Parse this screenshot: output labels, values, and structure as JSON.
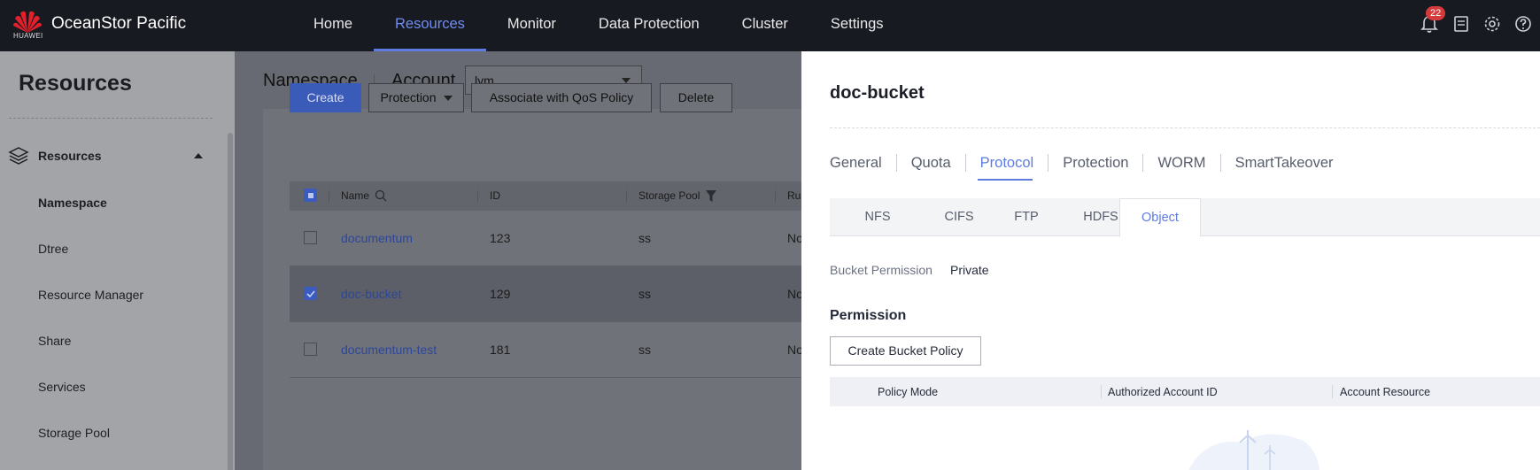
{
  "brand": {
    "company": "HUAWEI",
    "app_title": "OceanStor Pacific",
    "logo_color": "#e0202b"
  },
  "nav": {
    "items": [
      "Home",
      "Resources",
      "Monitor",
      "Data Protection",
      "Cluster",
      "Settings"
    ],
    "active": "Resources"
  },
  "topbar": {
    "notification_count": "22",
    "icons": [
      "bell-icon",
      "document-icon",
      "gear-icon",
      "help-icon"
    ]
  },
  "sidebar": {
    "title": "Resources",
    "group": {
      "label": "Resources",
      "icon": "layers-icon",
      "expanded": true
    },
    "items": [
      "Namespace",
      "Dtree",
      "Resource Manager",
      "Share",
      "Services",
      "Storage Pool"
    ],
    "active": "Namespace"
  },
  "main": {
    "title": "Namespace",
    "account_label": "Account",
    "account_value": "lym",
    "toolbar": {
      "create": "Create",
      "protection": "Protection",
      "associate_qos": "Associate with QoS Policy",
      "delete": "Delete"
    },
    "table": {
      "columns": [
        "Name",
        "ID",
        "Storage Pool",
        "Ru"
      ],
      "rows": [
        {
          "name": "documentum",
          "id": "123",
          "pool": "ss",
          "extra": "No",
          "checked": false
        },
        {
          "name": "doc-bucket",
          "id": "129",
          "pool": "ss",
          "extra": "No",
          "checked": true
        },
        {
          "name": "documentum-test",
          "id": "181",
          "pool": "ss",
          "extra": "No",
          "checked": false
        }
      ]
    }
  },
  "drawer": {
    "title": "doc-bucket",
    "tabs": [
      "General",
      "Quota",
      "Protocol",
      "Protection",
      "WORM",
      "SmartTakeover"
    ],
    "active_tab": "Protocol",
    "protocol_tabs": [
      "NFS",
      "CIFS",
      "FTP",
      "HDFS",
      "Object"
    ],
    "active_protocol_tab": "Object",
    "bucket_permission_label": "Bucket Permission",
    "bucket_permission_value": "Private",
    "permission_title": "Permission",
    "create_policy_button": "Create Bucket Policy",
    "policy_columns": [
      "Policy Mode",
      "Authorized Account ID",
      "Account Resource"
    ]
  },
  "colors": {
    "accent": "#5e7ce0",
    "topbar_bg": "#181a22",
    "primary_button": "#3b5bb8",
    "badge": "#d43a3a"
  }
}
